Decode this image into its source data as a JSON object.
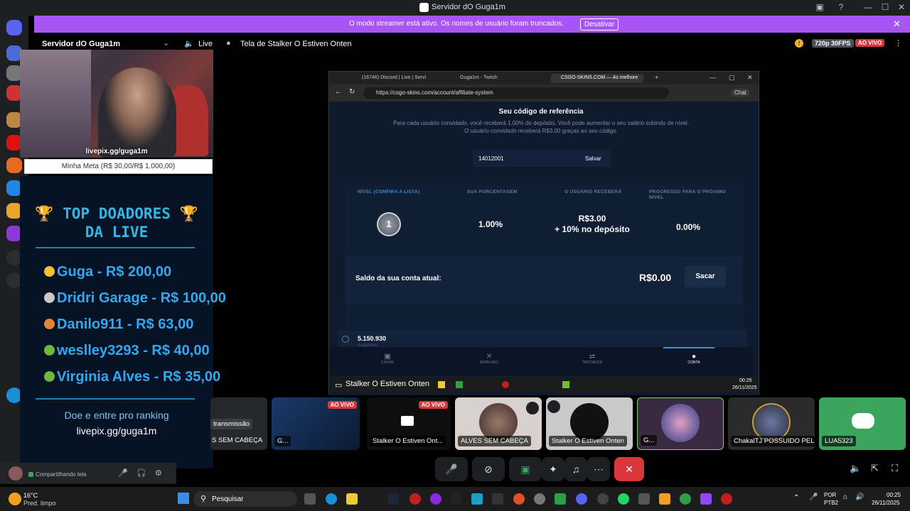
{
  "window": {
    "title": "Servidor dO Guga1m"
  },
  "banner": {
    "message": "O modo streamer está ativo. Os nomes de usuário foram truncados.",
    "button": "Desativar"
  },
  "topbar": {
    "server_name": "Servidor dO Guga1m",
    "channel": "Live",
    "stream_title": "Tela de Stalker O Estiven Onten",
    "quality": "720p 30FPS",
    "live_badge": "AO VIVO"
  },
  "overlay": {
    "webcam_tag": "livepix.gg/guga1m",
    "goal": "Minha Meta (R$ 30,00/R$ 1.000,00)",
    "heading_line1": "🏆 TOP DOADORES 🏆",
    "heading_line2": "DA LIVE",
    "donors": [
      {
        "text": "Guga - R$ 200,00",
        "medal_color": "#f2c230"
      },
      {
        "text": "Dridri Garage - R$ 100,00",
        "medal_color": "#c9c9c9"
      },
      {
        "text": "Danilo911 - R$ 63,00",
        "medal_color": "#e0843a"
      },
      {
        "text": "weslley3293 - R$ 40,00",
        "medal_color": "#6fb83a"
      },
      {
        "text": "Virginia Alves - R$ 35,00",
        "medal_color": "#6fb83a"
      }
    ],
    "cta_line1": "Doe e entre pro ranking",
    "cta_line2": "livepix.gg/guga1m"
  },
  "browser": {
    "tabs": [
      "(16746) Discord | Live | Servi",
      "Guga1m - Twitch",
      "CSGO-SKINS.COM — As melhore"
    ],
    "url": "https://csgo-skins.com/account/affiliate-system",
    "chat_label": "Chat"
  },
  "affiliate": {
    "title": "Seu código de referência",
    "description": "Para cada usuário convidado, você receberá 1.00% do depósito. Você pode aumentar o seu salário subindo de nível. O usuário convidado receberá R$3.00 graças ao seu código.",
    "code": "14012001",
    "save": "Salvar",
    "col_level": "NÍVEL",
    "col_level_link": "(CONFIRA A LISTA)",
    "col_percent": "SUA PORCENTAGEM",
    "col_user_gets": "O USUÁRIO RECEBERÁ",
    "col_progress": "PROGRESSO PARA O PRÓXIMO NÍVEL",
    "level": "1",
    "percent": "1.00%",
    "user_gets_1": "R$3.00",
    "user_gets_2": "+ 10% no depósito",
    "progress": "0.00%",
    "balance_label": "Saldo da sua conta atual:",
    "balance_value": "R$0.00",
    "withdraw": "Sacar",
    "counter": "5.150.930",
    "counter_sub": "Jogadores",
    "nav": [
      "CAIXAS",
      "BATALHAS",
      "TROCADOR",
      "CONTA"
    ]
  },
  "app_taskbar": {
    "sharer": "Stalker O Estiven Onten",
    "time": "00:25",
    "date": "26/11/2025"
  },
  "participants": [
    {
      "name": "transmissão",
      "type": "partial"
    },
    {
      "name": "G...",
      "live": "AO VIVO"
    },
    {
      "name": "Stalker O Estiven Ont...",
      "live": "AO VIVO"
    },
    {
      "name": "ALVES SEM CABEÇA"
    },
    {
      "name": "Stalker O Estiven Onten"
    },
    {
      "name": "G..."
    },
    {
      "name": "ChakalTJ POSSUIDO PEL..."
    },
    {
      "name": "LUA5323"
    }
  ],
  "partial_tile_text": "S SEM CABEÇA",
  "user_panel": {
    "status": "Compartilhando tela"
  },
  "taskbar": {
    "weather_temp": "16°C",
    "weather_desc": "Pred. limpo",
    "search": "Pesquisar",
    "lang1": "POR",
    "lang2": "PTB2",
    "time": "00:25",
    "date": "26/11/2025"
  }
}
